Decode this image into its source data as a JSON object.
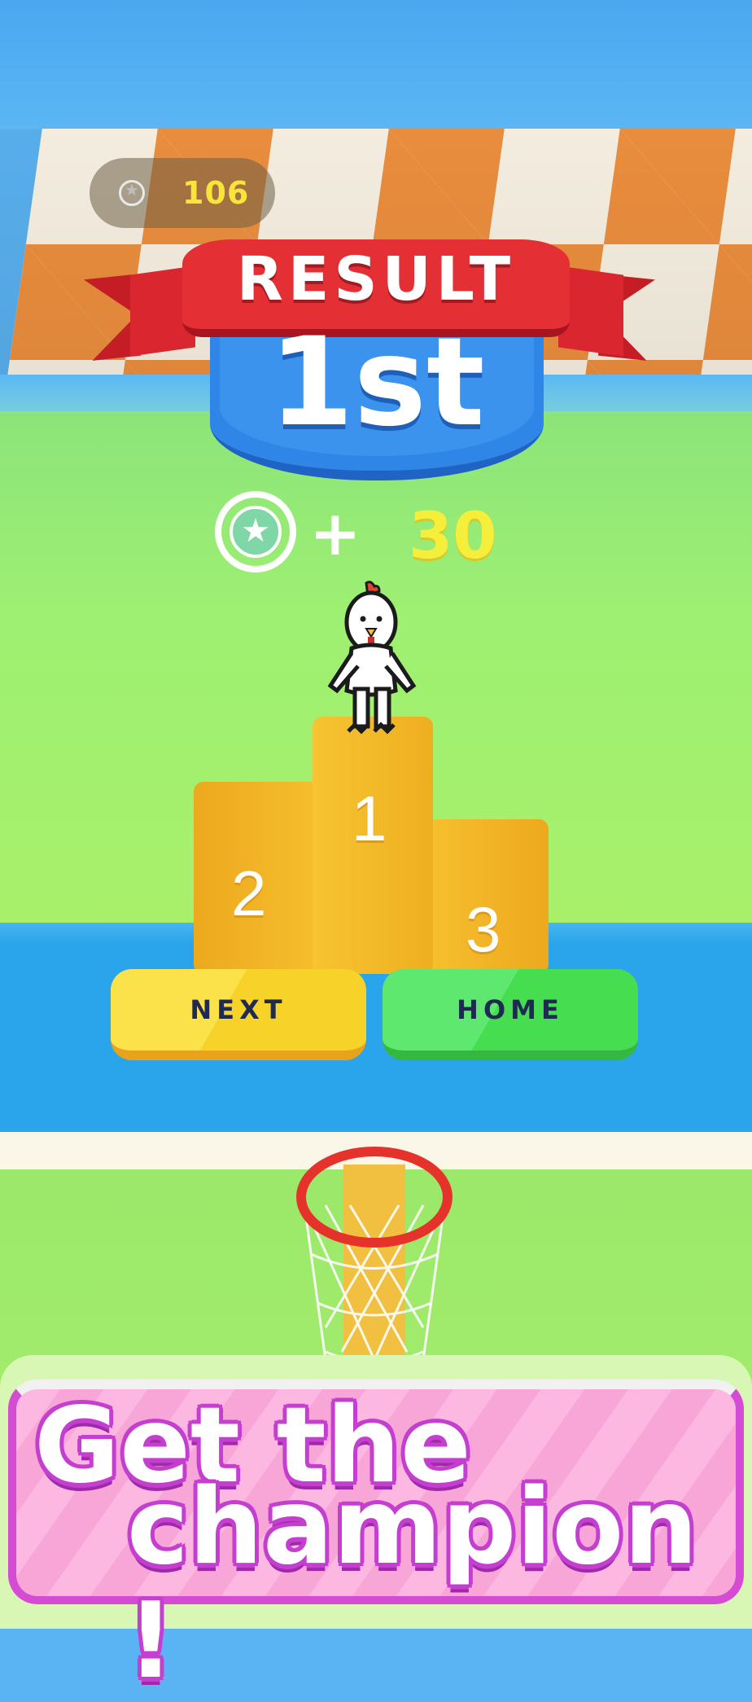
{
  "hud": {
    "coin_icon": "star-coin-icon",
    "coin_count": "106"
  },
  "result": {
    "title": "RESULT",
    "place": "1st"
  },
  "reward": {
    "coin_icon": "star-coin-icon",
    "plus": "+",
    "value": "30"
  },
  "podium": {
    "first": "1",
    "second": "2",
    "third": "3"
  },
  "buttons": {
    "next_label": "NEXT",
    "home_label": "HOME"
  },
  "banner": {
    "line1": "Get the",
    "line2": "champion !"
  },
  "colors": {
    "coin_text": "#f7e53b",
    "ribbon": "#e42f35",
    "badge": "#2f86e6",
    "next_button": "#fbe14a",
    "home_button": "#46dd51",
    "banner_outline": "#c43fd0"
  }
}
